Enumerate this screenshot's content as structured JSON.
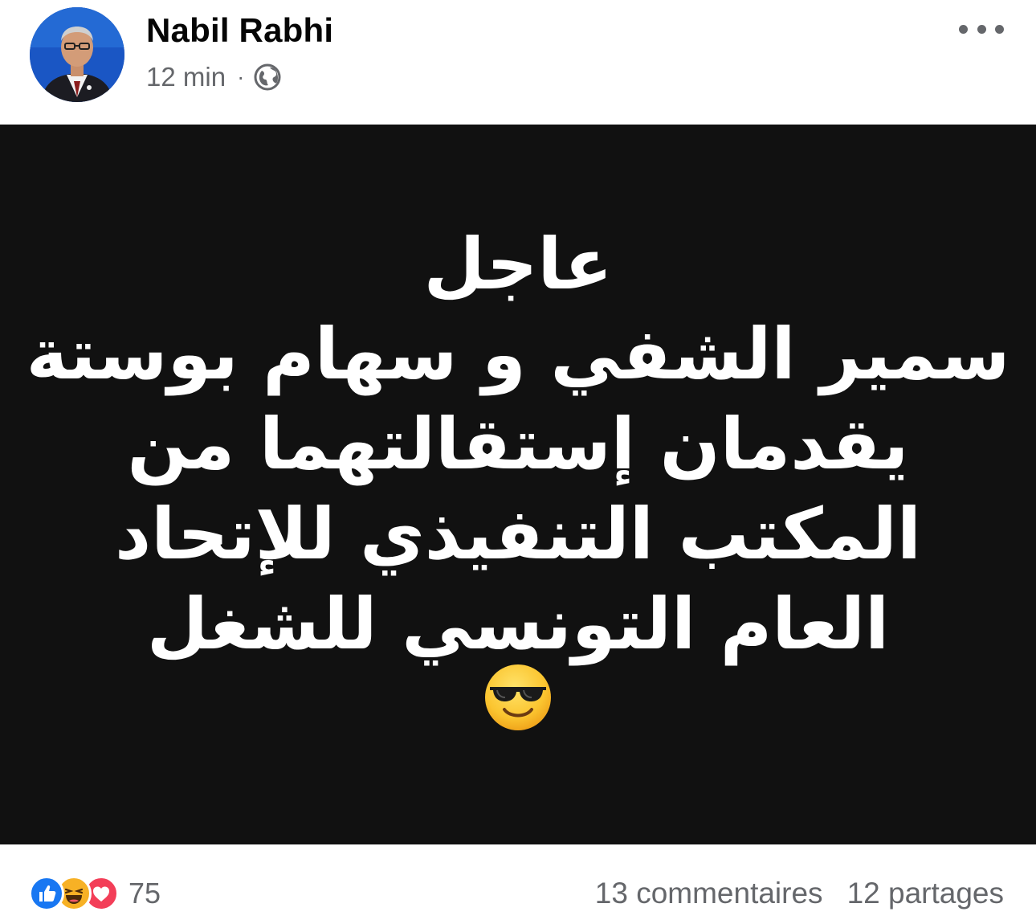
{
  "header": {
    "author_name": "Nabil Rabhi",
    "timestamp": "12 min",
    "separator": "·",
    "privacy_icon": "globe-icon",
    "more_icon": "more-options-icon"
  },
  "post": {
    "background_color": "#111111",
    "text_color": "#ffffff",
    "lines": [
      "عاجل",
      "سمير الشفي و سهام بوستة",
      "يقدمان إستقالتهما من",
      "المكتب التنفيذي للإتحاد",
      "العام التونسي للشغل"
    ],
    "emoji": "smiling-face-with-sunglasses"
  },
  "footer": {
    "reactions": [
      "like",
      "haha",
      "love"
    ],
    "reaction_count": "75",
    "comments": "13 commentaires",
    "shares": "12 partages"
  },
  "colors": {
    "secondary_text": "#65676b",
    "like": "#1877f2",
    "haha": "#f7b125",
    "love": "#f33e58"
  }
}
